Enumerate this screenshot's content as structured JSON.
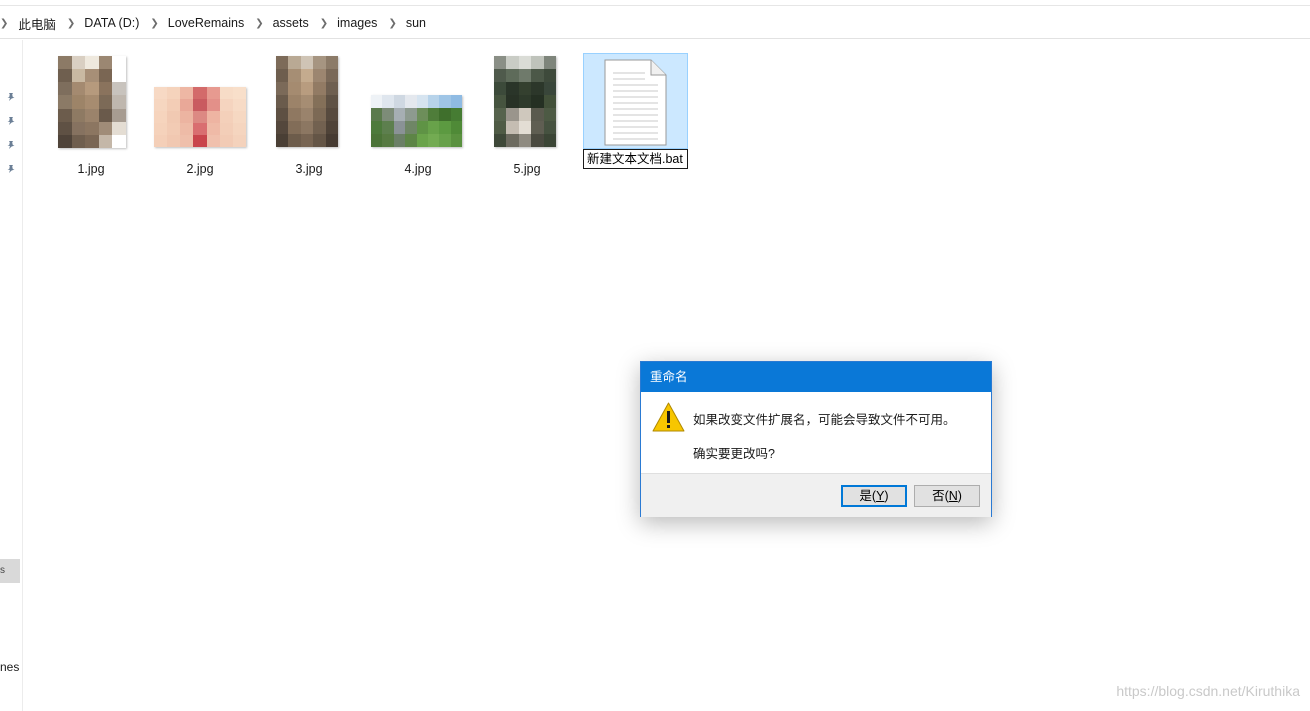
{
  "breadcrumb": {
    "items": [
      "此电脑",
      "DATA (D:)",
      "LoveRemains",
      "assets",
      "images",
      "sun"
    ]
  },
  "navpane": {
    "pinned_count": 4,
    "selected_fragment": "s",
    "bottom_fragment": "nes"
  },
  "files": [
    {
      "name": "1.jpg",
      "kind": "image"
    },
    {
      "name": "2.jpg",
      "kind": "image"
    },
    {
      "name": "3.jpg",
      "kind": "image"
    },
    {
      "name": "4.jpg",
      "kind": "image"
    },
    {
      "name": "5.jpg",
      "kind": "image"
    },
    {
      "name": "新建文本文档.bat",
      "kind": "text-file",
      "state": "renaming"
    }
  ],
  "dialog": {
    "title": "重命名",
    "message_line1": "如果改变文件扩展名，可能会导致文件不可用。",
    "message_line2": "确实要更改吗?",
    "yes_label": "是(",
    "yes_key": "Y",
    "yes_suffix": ")",
    "no_label": "否(",
    "no_key": "N",
    "no_suffix": ")"
  },
  "watermark": "https://blog.csdn.net/Kiruthika",
  "colors": {
    "title_bar": "#0a78d7",
    "selection_fill": "#cce8ff",
    "selection_border": "#99d1ff",
    "warning_yellow": "#f7c600",
    "focus_border": "#0078d7"
  },
  "icons": {
    "chevron": "chevron-right-icon",
    "pin": "pin-icon",
    "warning": "warning-icon",
    "document": "document-icon"
  }
}
